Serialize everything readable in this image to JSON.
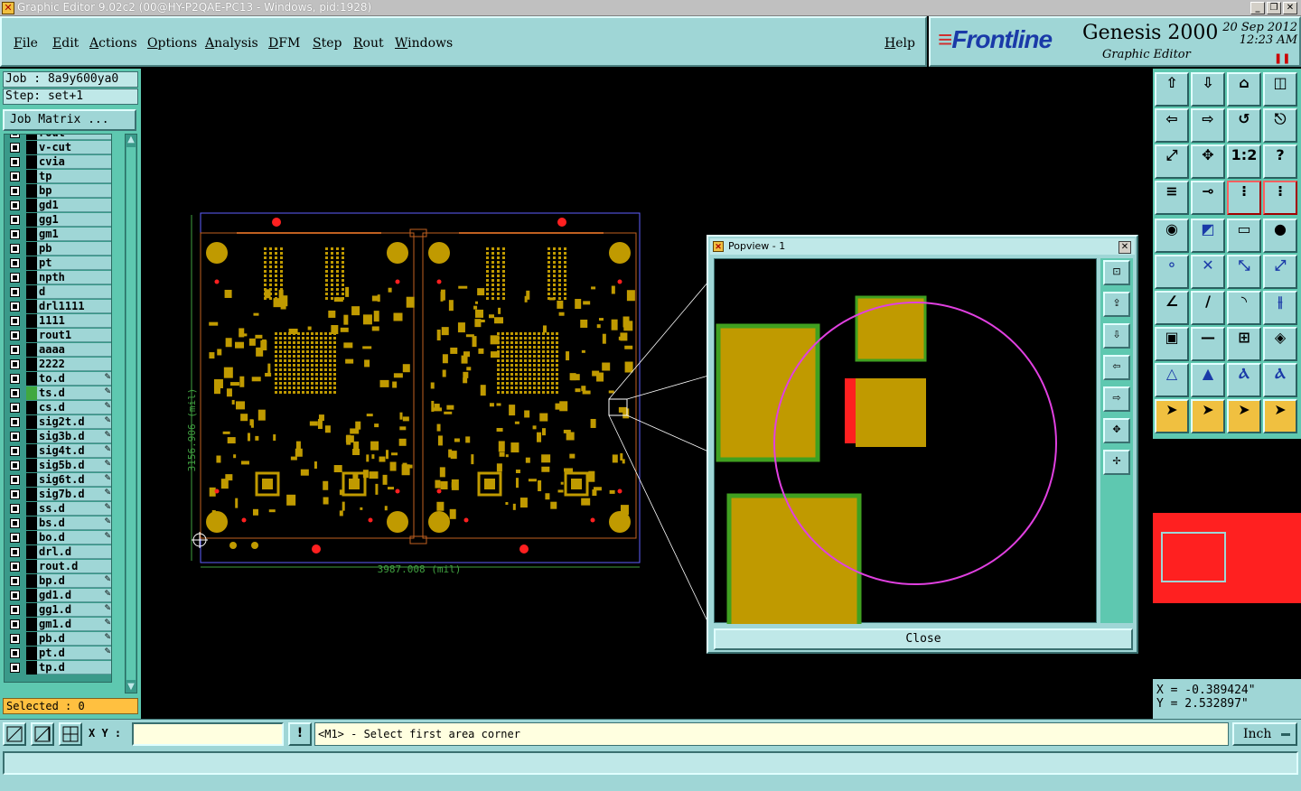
{
  "window": {
    "title": "Graphic Editor 9.02c2 (00@HY-P2QAE-PC13 - Windows, pid:1928)",
    "buttons": [
      "_",
      "❐",
      "✕"
    ]
  },
  "menu": [
    "File",
    "Edit",
    "Actions",
    "Options",
    "Analysis",
    "DFM",
    "Step",
    "Rout",
    "Windows"
  ],
  "help": "Help",
  "brand": {
    "logo": "Frontline",
    "product": "Genesis 2000",
    "subtitle": "Graphic Editor",
    "date": "20 Sep 2012",
    "time": "12:23 AM"
  },
  "job": {
    "job_label": "Job : 8a9y600ya0",
    "step_label": "Step: set+1",
    "matrix_button": "Job Matrix ..."
  },
  "layers": [
    {
      "name": "rout",
      "editable": false
    },
    {
      "name": "v-cut",
      "editable": false
    },
    {
      "name": "cvia",
      "editable": false
    },
    {
      "name": "tp",
      "editable": false
    },
    {
      "name": "bp",
      "editable": false
    },
    {
      "name": "gd1",
      "editable": false
    },
    {
      "name": "gg1",
      "editable": false
    },
    {
      "name": "gm1",
      "editable": false
    },
    {
      "name": "pb",
      "editable": false
    },
    {
      "name": "pt",
      "editable": false
    },
    {
      "name": "npth",
      "editable": false
    },
    {
      "name": "d",
      "editable": false
    },
    {
      "name": "drl1111",
      "editable": false
    },
    {
      "name": "1111",
      "editable": false
    },
    {
      "name": "rout1",
      "editable": false
    },
    {
      "name": "aaaa",
      "editable": false
    },
    {
      "name": "2222",
      "editable": false
    },
    {
      "name": "to.d",
      "editable": true
    },
    {
      "name": "ts.d",
      "editable": true,
      "active": true
    },
    {
      "name": "cs.d",
      "editable": true
    },
    {
      "name": "sig2t.d",
      "editable": true
    },
    {
      "name": "sig3b.d",
      "editable": true
    },
    {
      "name": "sig4t.d",
      "editable": true
    },
    {
      "name": "sig5b.d",
      "editable": true
    },
    {
      "name": "sig6t.d",
      "editable": true
    },
    {
      "name": "sig7b.d",
      "editable": true
    },
    {
      "name": "ss.d",
      "editable": true
    },
    {
      "name": "bs.d",
      "editable": true
    },
    {
      "name": "bo.d",
      "editable": true
    },
    {
      "name": "drl.d",
      "editable": false
    },
    {
      "name": "rout.d",
      "editable": false
    },
    {
      "name": "bp.d",
      "editable": true
    },
    {
      "name": "gd1.d",
      "editable": true
    },
    {
      "name": "gg1.d",
      "editable": true
    },
    {
      "name": "gm1.d",
      "editable": true
    },
    {
      "name": "pb.d",
      "editable": true
    },
    {
      "name": "pt.d",
      "editable": true
    },
    {
      "name": "tp.d",
      "editable": false
    }
  ],
  "selected_label": "Selected : 0",
  "canvas": {
    "dim_vertical": "3156.906 (mil)",
    "dim_horizontal": "3987.008 (mil)"
  },
  "popview": {
    "title": "Popview - 1",
    "close_label": "Close",
    "close_x": "✕"
  },
  "coords": {
    "x": "X = -0.389424\"",
    "y": "Y = 2.532897\""
  },
  "bottom": {
    "xy_label": "X Y :",
    "excl": "!",
    "prompt": "<M1> - Select first area corner",
    "units": "Inch"
  },
  "colors": {
    "panel": "#9fd6d6",
    "teal": "#5ec8b0",
    "pad": "#c09a00",
    "pad_edge": "#40a020",
    "highlight": "#ff2020",
    "circle": "#e040e0"
  }
}
